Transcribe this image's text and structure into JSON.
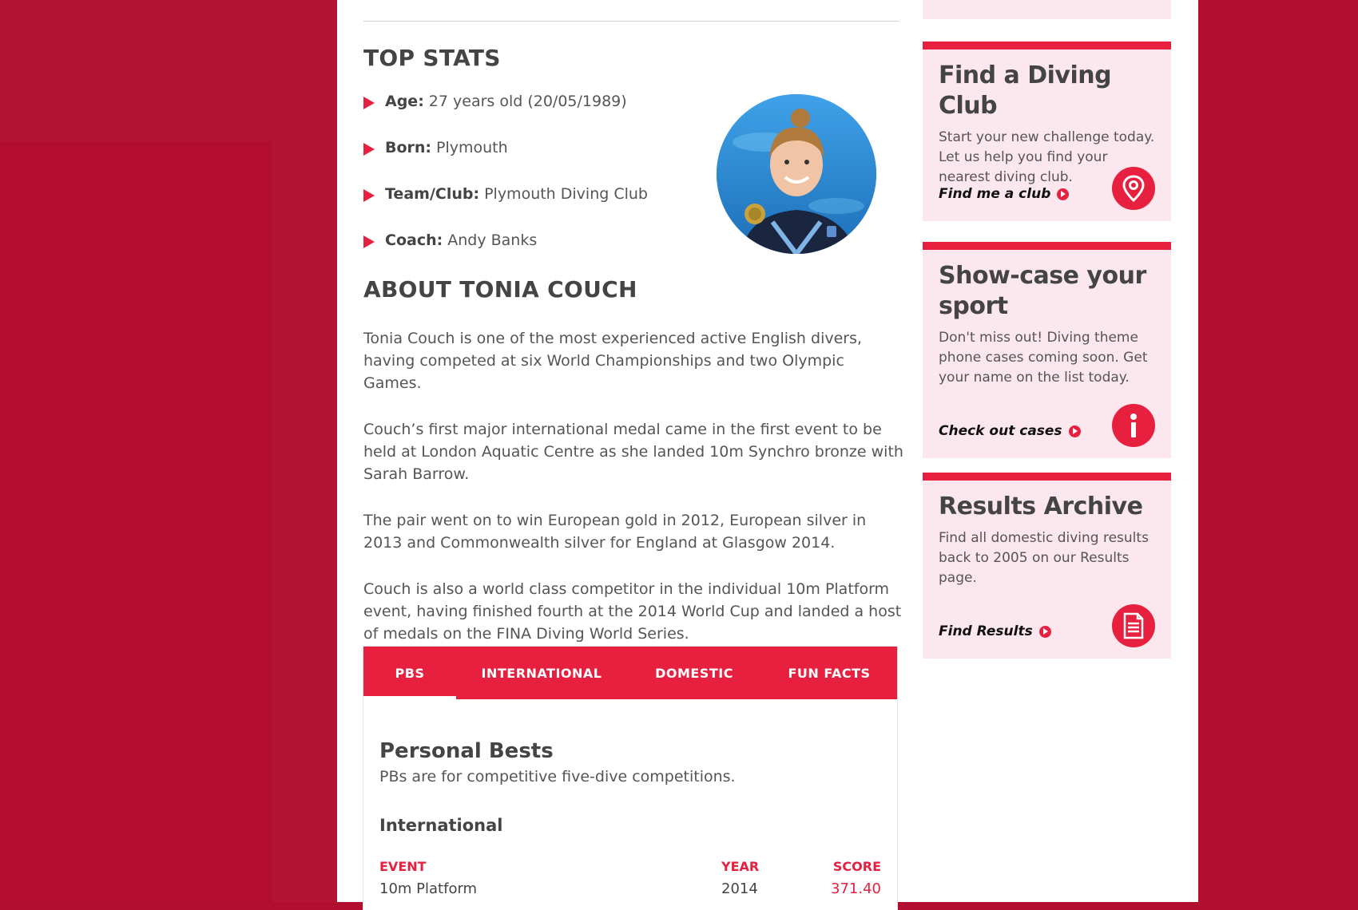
{
  "top_stats": {
    "heading": "TOP STATS",
    "items": [
      {
        "label": "Age:",
        "value": "27 years old (20/05/1989)"
      },
      {
        "label": "Born:",
        "value": "Plymouth"
      },
      {
        "label": "Team/Club:",
        "value": "Plymouth Diving Club"
      },
      {
        "label": "Coach:",
        "value": "Andy Banks"
      }
    ]
  },
  "about": {
    "heading": "ABOUT TONIA COUCH",
    "paragraphs": [
      "Tonia Couch is one of the most experienced active English divers, having competed at six World Championships and two Olympic Games.",
      "Couch’s first major international medal came in the first event to be held at London Aquatic Centre as she landed 10m Synchro bronze with Sarah Barrow.",
      "The pair went on to win European gold in 2012, European silver in 2013 and Commonwealth silver for England at Glasgow 2014.",
      "Couch is also a world class competitor in the individual 10m Platform event, having finished fourth at the 2014 World Cup and landed a host of medals on the FINA Diving World Series."
    ]
  },
  "tabs": {
    "items": [
      "PBS",
      "INTERNATIONAL",
      "DOMESTIC",
      "FUN FACTS"
    ],
    "active": "PBS"
  },
  "personal_bests": {
    "title": "Personal Bests",
    "subtitle": "PBs are for competitive five-dive competitions.",
    "section": "International",
    "columns": {
      "event": "EVENT",
      "year": "YEAR",
      "score": "SCORE"
    },
    "rows": [
      {
        "event": "10m Platform",
        "year": "2014",
        "score": "371.40"
      }
    ]
  },
  "sidebar": {
    "cards": [
      {
        "title": "Find a Diving Club",
        "text": "Start your new challenge today. Let us help you find your nearest diving club.",
        "link": "Find me a club",
        "icon": "location-pin-icon"
      },
      {
        "title": "Show-case your sport",
        "text": "Don't miss out! Diving theme phone cases coming soon. Get your name on the list today.",
        "link": "Check out cases",
        "icon": "info-icon"
      },
      {
        "title": "Results Archive",
        "text": "Find all domestic diving results back to 2005 on our Results page.",
        "link": "Find Results",
        "icon": "document-icon"
      }
    ]
  },
  "colors": {
    "accent": "#e8203f",
    "background": "#b10e30",
    "card_bg": "#fce7ef"
  }
}
